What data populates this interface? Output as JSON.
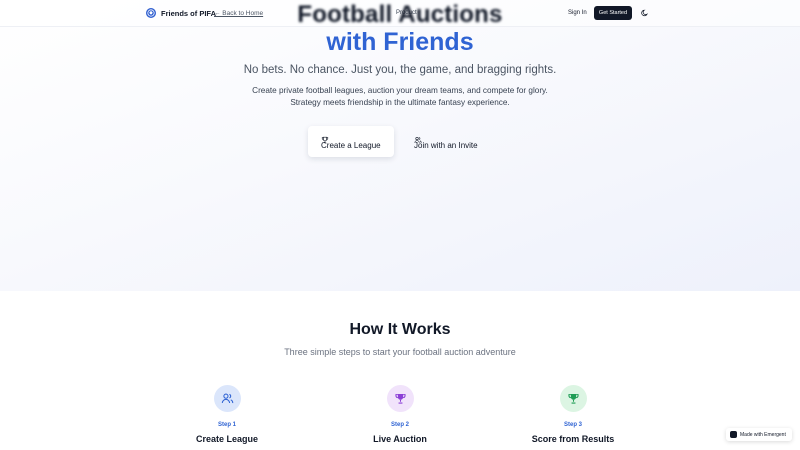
{
  "nav": {
    "brand": "Friends of PIFA",
    "back_link": "← Back to Home",
    "product": "Product",
    "sign_in": "Sign In",
    "get_started": "Get Started"
  },
  "hero": {
    "title_line1": "Football Auctions",
    "title_line2": "with Friends",
    "tagline": "No bets. No chance. Just you, the game, and bragging rights.",
    "description": "Create private football leagues, auction your dream teams, and compete for glory. Strategy meets friendship in the ultimate fantasy experience.",
    "primary_button": "Create a League",
    "secondary_button": "Join with an Invite"
  },
  "how": {
    "title": "How It Works",
    "subtitle": "Three simple steps to start your football auction adventure",
    "steps": [
      {
        "number": "Step 1",
        "title": "Create League",
        "icon": "users-icon",
        "color": "#dbe6fb"
      },
      {
        "number": "Step 2",
        "title": "Live Auction",
        "icon": "trophy-icon",
        "color": "#f1e3fb"
      },
      {
        "number": "Step 3",
        "title": "Score from Results",
        "icon": "trophy-icon",
        "color": "#dcf5e3"
      }
    ]
  },
  "badge": {
    "label": "Made with Emergent"
  },
  "colors": {
    "accent": "#2f63d3",
    "dark": "#111827"
  }
}
